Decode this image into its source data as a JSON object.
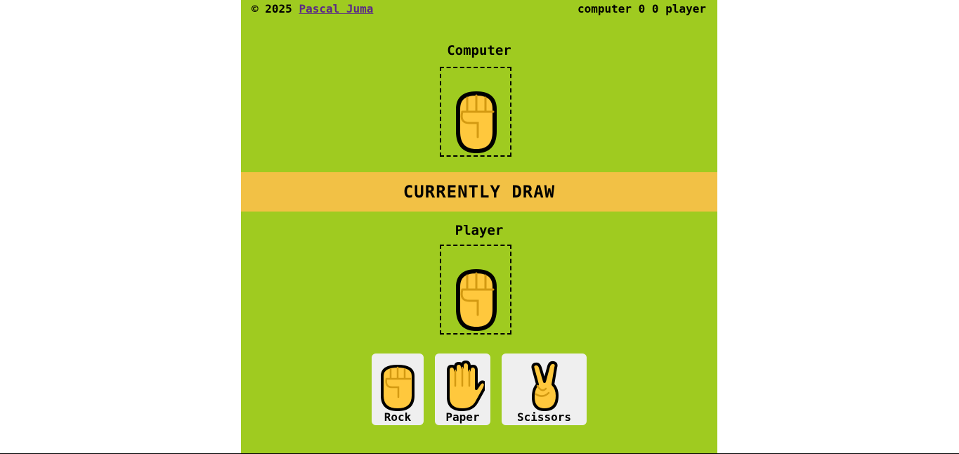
{
  "topbar": {
    "copyright_prefix": "© 2025",
    "author_link": "Pascal Juma",
    "score_text": "computer 0 0 player"
  },
  "computer": {
    "label": "Computer",
    "choice_icon": "rock-fist-icon"
  },
  "result": {
    "text": "CURRENTLY DRAW"
  },
  "player": {
    "label": "Player",
    "choice_icon": "rock-fist-icon"
  },
  "choices": [
    {
      "label": "Rock",
      "icon": "rock-fist-icon"
    },
    {
      "label": "Paper",
      "icon": "paper-hand-icon"
    },
    {
      "label": "Scissors",
      "icon": "scissors-victory-icon"
    }
  ],
  "colors": {
    "background": "#9fcb20",
    "result_band": "#f2c145",
    "hand_fill": "#ffc83d",
    "hand_line": "#d39a12",
    "link": "#5b2a86",
    "button_bg": "#efefef"
  }
}
